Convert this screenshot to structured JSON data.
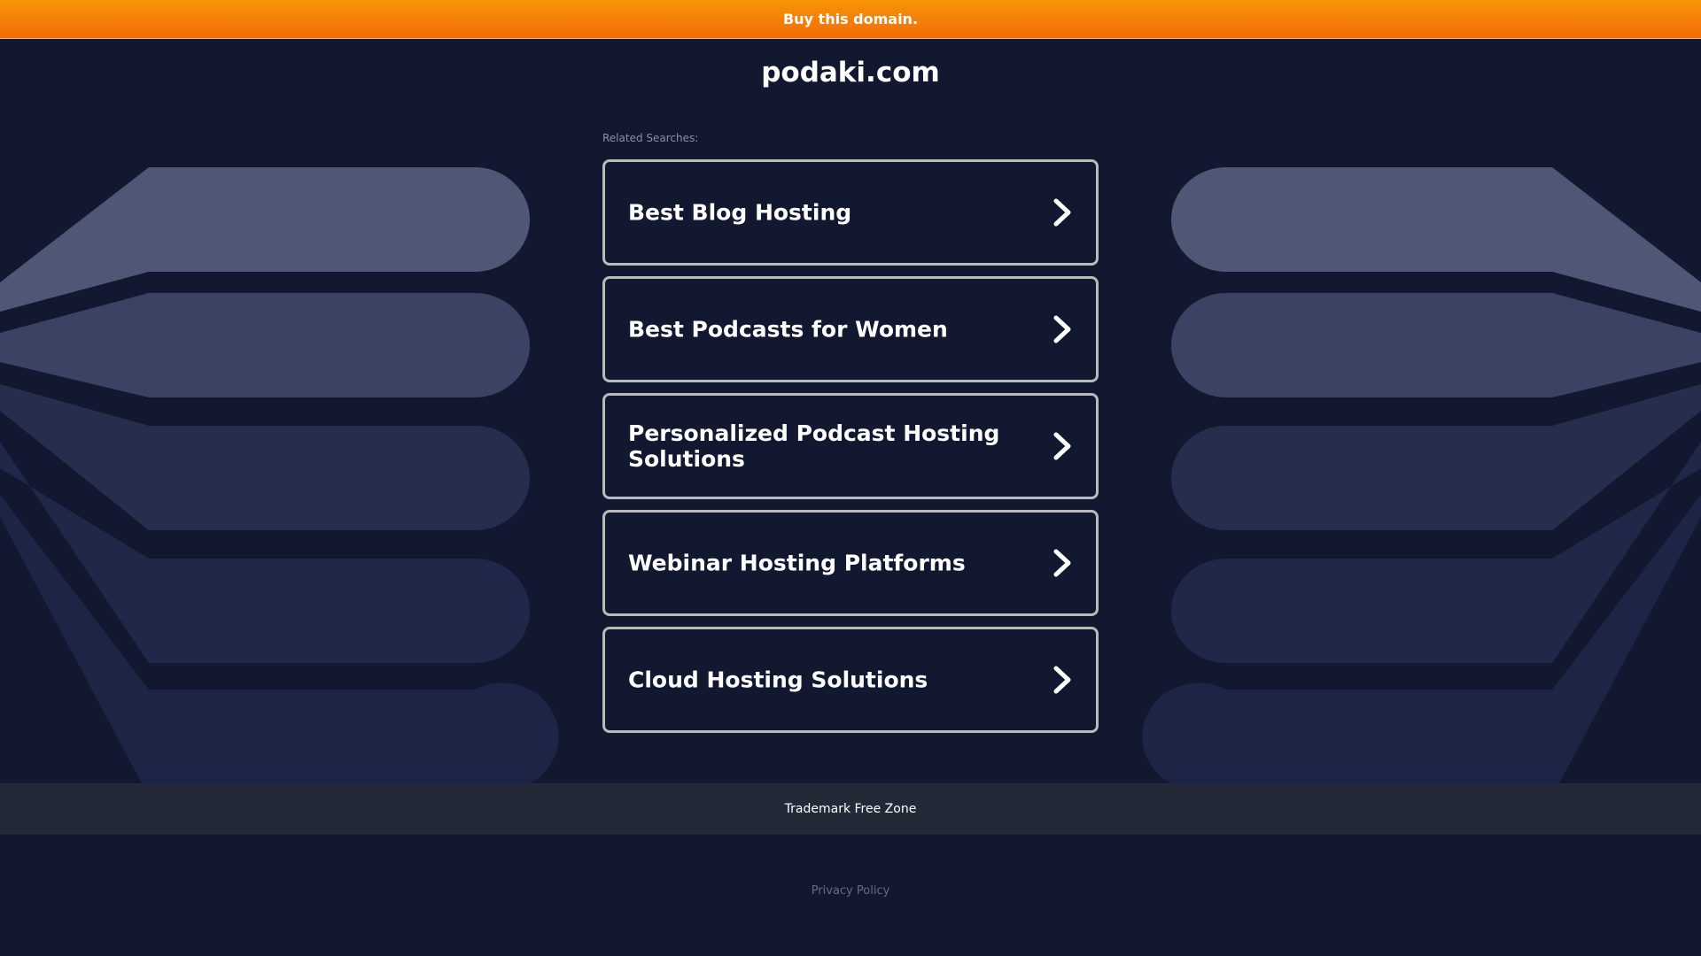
{
  "topbar": {
    "label": "Buy this domain."
  },
  "site": {
    "title": "podaki.com"
  },
  "related": {
    "label": "Related Searches:",
    "items": [
      {
        "label": "Best Blog Hosting"
      },
      {
        "label": "Best Podcasts for Women"
      },
      {
        "label": "Personalized Podcast Hosting Solutions"
      },
      {
        "label": "Webinar Hosting Platforms"
      },
      {
        "label": "Cloud Hosting Solutions"
      }
    ]
  },
  "footer": {
    "trademark": "Trademark Free Zone",
    "privacy": "Privacy Policy"
  },
  "icons": {
    "card_arrow": "chevron-right-icon"
  },
  "colors": {
    "topbar_start": "#f79408",
    "topbar_end": "#f26d06",
    "background": "#111830",
    "card_border": "#b9b9bc",
    "footer_band": "#232936"
  }
}
